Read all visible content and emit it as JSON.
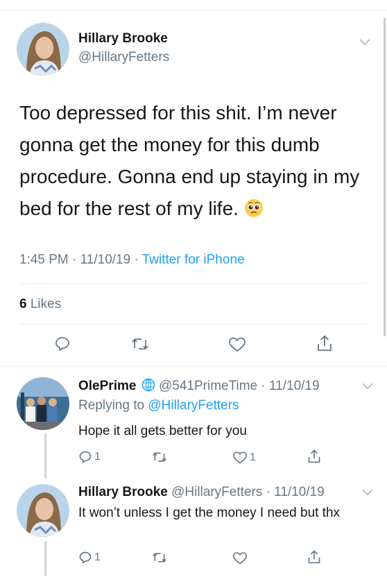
{
  "main_tweet": {
    "name": "Hillary Brooke",
    "handle": "@HillaryFetters",
    "text": "Too depressed for this shit. I’m never gonna get the money for this dumb procedure. Gonna end up staying in my bed for the rest of my life.",
    "time": "1:45 PM · 11/10/19 · ",
    "source": "Twitter for iPhone",
    "likes_count": "6",
    "likes_label": " Likes",
    "emoji": "pleading-face"
  },
  "reply1": {
    "name": "OlePrime",
    "handle_time": " @541PrimeTime · 11/10/19",
    "replying_label": "Replying to ",
    "replying_to": "@HillaryFetters",
    "text": "Hope it all gets better for you",
    "reply_count": "1",
    "like_count": "1"
  },
  "reply2": {
    "name": "Hillary Brooke",
    "handle_time": " @HillaryFetters · 11/10/19",
    "text": "It won’t unless I get the money I need but thx",
    "reply_count": "1"
  },
  "colors": {
    "accent": "#1da1f2",
    "secondary_text": "#657786",
    "divider": "#e6ecf0"
  }
}
